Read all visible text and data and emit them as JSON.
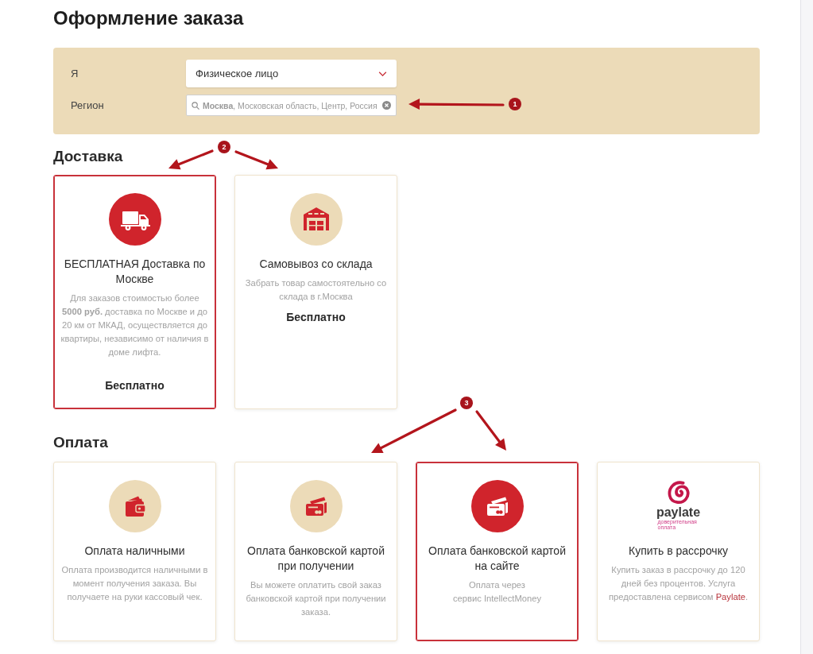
{
  "page_title": "Оформление заказа",
  "customer_form": {
    "fields": [
      {
        "kind": "select",
        "label": "Я",
        "value": "Физическое лицо"
      },
      {
        "kind": "search",
        "label": "Регион",
        "value": "**Москва**, Московская область, Центр, Россия"
      }
    ]
  },
  "delivery": {
    "title": "Доставка",
    "options": [
      {
        "selected": true,
        "title": "БЕСПЛАТНАЯ Доставка по Москве",
        "description": "Для заказов стоимостью более **5000 руб.** доставка по Москве и до 20 км от МКАД, осуществляется до квартиры, независимо от наличия в доме лифта.",
        "price": "Бесплатно"
      },
      {
        "selected": false,
        "title": "Самовывоз со склада",
        "description": "Забрать товар самостоятельно со склада в г.Москва",
        "price": "Бесплатно"
      }
    ]
  },
  "payment": {
    "title": "Оплата",
    "options": [
      {
        "kind": "icon",
        "selected": false,
        "title": "Оплата наличными",
        "description": "Оплата производится наличными в момент получения заказа. Вы получаете на руки кассовый чек."
      },
      {
        "kind": "icon",
        "selected": false,
        "title": "Оплата банковской картой при получении",
        "description": "Вы можете оплатить свой заказ банковской картой при получении заказа."
      },
      {
        "kind": "icon",
        "selected": true,
        "title": "Оплата банковской картой на сайте",
        "description": "Оплата через\nсервис IntellectMoney"
      },
      {
        "kind": "logo",
        "selected": false,
        "logo": {
          "name": "paylate",
          "tagline": "доверительная оплата"
        },
        "title": "Купить в рассрочку",
        "description": "Купить заказ в рассрочку до 120 дней без процентов. Услуга предоставлена сервисом",
        "link": "Paylate",
        "link_suffix": "."
      }
    ]
  },
  "annotations": [
    {
      "number": "1"
    },
    {
      "number": "2"
    },
    {
      "number": "3"
    }
  ]
}
